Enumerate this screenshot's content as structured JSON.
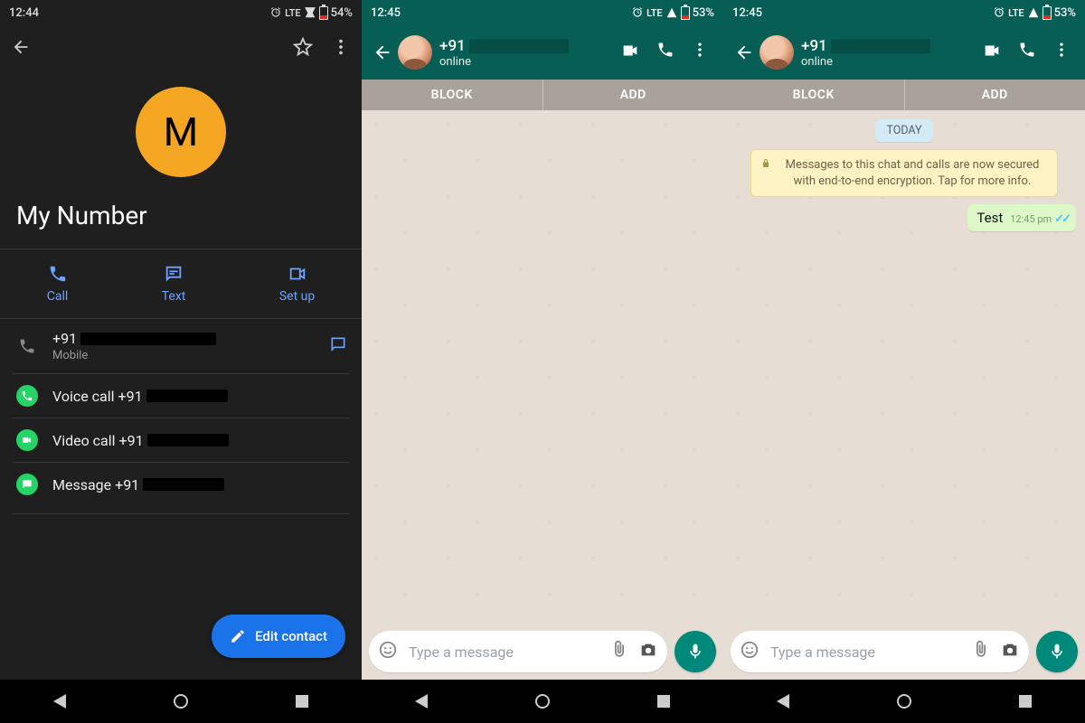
{
  "panel1": {
    "status": {
      "time": "12:44",
      "lte": "LTE",
      "battery": "54%"
    },
    "avatar_initial": "M",
    "contact_name": "My Number",
    "actions": {
      "call": "Call",
      "text": "Text",
      "setup": "Set up"
    },
    "phone": {
      "prefix": "+91",
      "redacted": true,
      "type_label": "Mobile"
    },
    "wa_rows": {
      "voice": "Voice call +91",
      "video": "Video call +91",
      "message": "Message +91"
    },
    "fab_label": "Edit contact"
  },
  "panel2": {
    "status": {
      "time": "12:45",
      "lte": "LTE",
      "battery": "53%"
    },
    "header": {
      "prefix": "+91",
      "redacted": true,
      "status": "online"
    },
    "block_add": {
      "block": "BLOCK",
      "add": "ADD"
    },
    "composer_placeholder": "Type a message"
  },
  "panel3": {
    "status": {
      "time": "12:45",
      "lte": "LTE",
      "battery": "53%"
    },
    "header": {
      "prefix": "+91",
      "redacted": true,
      "status": "online"
    },
    "block_add": {
      "block": "BLOCK",
      "add": "ADD"
    },
    "chat": {
      "date": "TODAY",
      "e2e": "Messages to this chat and calls are now secured with end-to-end encryption. Tap for more info.",
      "message": {
        "text": "Test",
        "time": "12:45 pm"
      }
    },
    "composer_placeholder": "Type a message"
  }
}
